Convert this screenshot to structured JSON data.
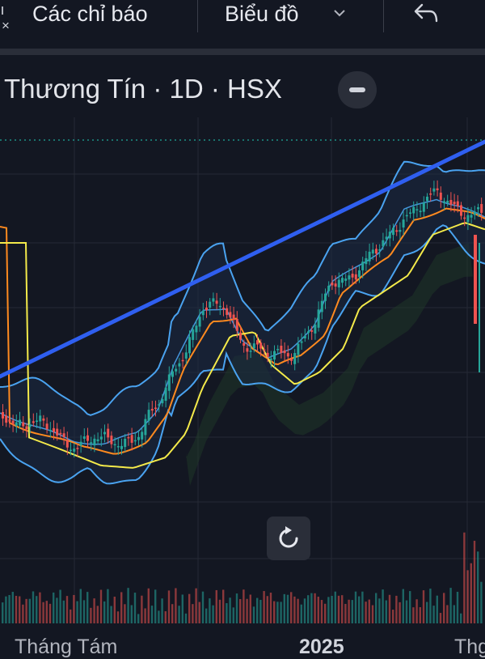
{
  "toolbar": {
    "close_symbol": "×",
    "indicators_label": "Các chỉ báo",
    "chart_type_label": "Biểu đồ",
    "chart_type_chevron_icon": "chevron-down-icon",
    "undo_icon": "undo-icon"
  },
  "legend": {
    "title": "Thương Tín · 1D · HSX",
    "collapse_icon": "minus-icon"
  },
  "chart": {
    "reset_icon": "reset-icon",
    "colors": {
      "background": "#131722",
      "grid": "#262a35",
      "trendline": "#2f5ff0",
      "bollinger": "#4aa3f0",
      "bollinger_fill": "#1c2a44",
      "ma_fast": "#ff8a1f",
      "ma_slow": "#f4ea4a",
      "up": "#26a69a",
      "down": "#ef5350",
      "cloud": "#1f3a27",
      "price_line": "#1fa89a"
    }
  },
  "time_axis": {
    "labels": [
      "Tháng Tám",
      "2025",
      "Thg"
    ]
  }
}
